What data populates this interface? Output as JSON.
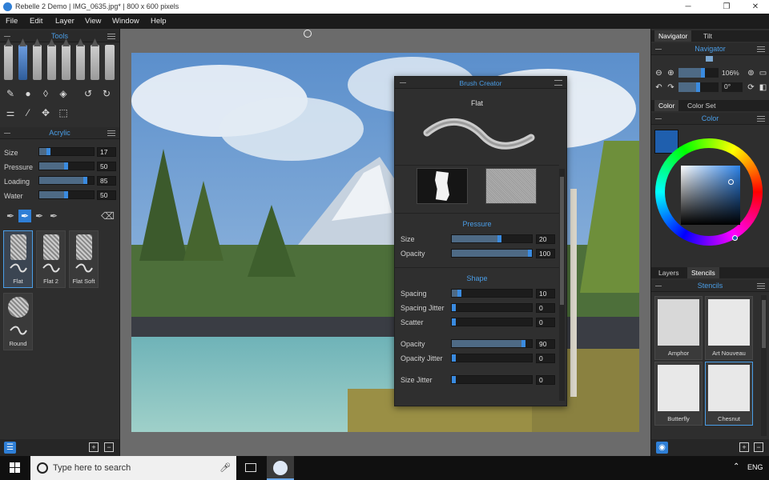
{
  "window": {
    "title": "Rebelle 2 Demo | IMG_0635.jpg* | 800 x 600 pixels",
    "minimize": "─",
    "maximize": "❐",
    "close": "✕"
  },
  "menu": [
    "File",
    "Edit",
    "Layer",
    "View",
    "Window",
    "Help"
  ],
  "tools_panel": {
    "title": "Tools"
  },
  "brush_panel": {
    "title": "Acrylic",
    "sliders": [
      {
        "label": "Size",
        "value": "17",
        "fraction": 0.17
      },
      {
        "label": "Pressure",
        "value": "50",
        "fraction": 0.5
      },
      {
        "label": "Loading",
        "value": "85",
        "fraction": 0.85
      },
      {
        "label": "Water",
        "value": "50",
        "fraction": 0.5
      }
    ],
    "variants": [
      {
        "label": "Flat",
        "selected": true
      },
      {
        "label": "Flat 2",
        "selected": false
      },
      {
        "label": "Flat Soft",
        "selected": false
      },
      {
        "label": "Round",
        "selected": false
      }
    ]
  },
  "brush_creator": {
    "title": "Brush Creator",
    "preset_name": "Flat",
    "pressure_header": "Pressure",
    "pressure": [
      {
        "label": "Size",
        "value": "20",
        "fraction": 0.6
      },
      {
        "label": "Opacity",
        "value": "100",
        "fraction": 1.0
      }
    ],
    "shape_header": "Shape",
    "shape": [
      {
        "label": "Spacing",
        "value": "10",
        "fraction": 0.1
      },
      {
        "label": "Spacing Jitter",
        "value": "0",
        "fraction": 0.0
      },
      {
        "label": "Scatter",
        "value": "0",
        "fraction": 0.0
      },
      {
        "label": "Opacity",
        "value": "90",
        "fraction": 0.9
      },
      {
        "label": "Opacity Jitter",
        "value": "0",
        "fraction": 0.0
      },
      {
        "label": "Size Jitter",
        "value": "0",
        "fraction": 0.0
      }
    ]
  },
  "navigator": {
    "tabs": [
      "Navigator",
      "Tilt"
    ],
    "title": "Navigator",
    "zoom": "106%",
    "rotation": "0°"
  },
  "color_panel": {
    "tabs": [
      "Color",
      "Color Set"
    ],
    "title": "Color",
    "current_color": "#1f5fae"
  },
  "stencils_panel": {
    "tabs": [
      "Layers",
      "Stencils"
    ],
    "title": "Stencils",
    "items": [
      {
        "label": "Amphor",
        "selected": false
      },
      {
        "label": "Art Nouveau",
        "selected": false
      },
      {
        "label": "Butterfly",
        "selected": false
      },
      {
        "label": "Chesnut",
        "selected": true
      }
    ]
  },
  "taskbar": {
    "search_placeholder": "Type here to search",
    "language": "ENG"
  },
  "colors": {
    "accent": "#4a9ee8",
    "panel": "#2e2e2e",
    "canvas_bg": "#6b6b6b"
  }
}
